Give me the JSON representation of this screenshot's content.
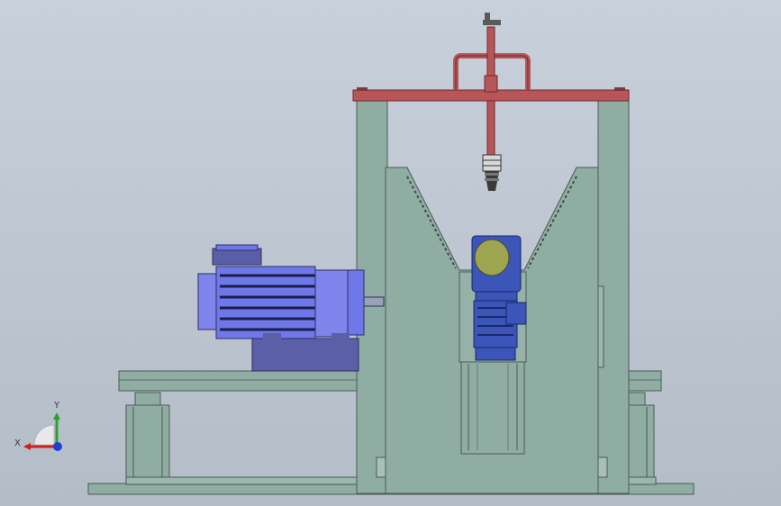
{
  "viewport": {
    "background_top": "#c8d0dc",
    "background_bottom": "#b4bcc8"
  },
  "model": {
    "frame_color": "#8fada3",
    "frame_edge_color": "#4a5a55",
    "crossbeam_color": "#b85558",
    "motor_color": "#6f78e8",
    "gear_motor_color": "#3b55b8",
    "gearbox_cover_color": "#9fa450",
    "base_plate_color": "#5a5fa8"
  },
  "triad": {
    "x_label": "X",
    "y_label": "Y",
    "x_color": "#d11f1f",
    "y_color": "#2aa12a",
    "z_color": "#1f3fd1"
  }
}
